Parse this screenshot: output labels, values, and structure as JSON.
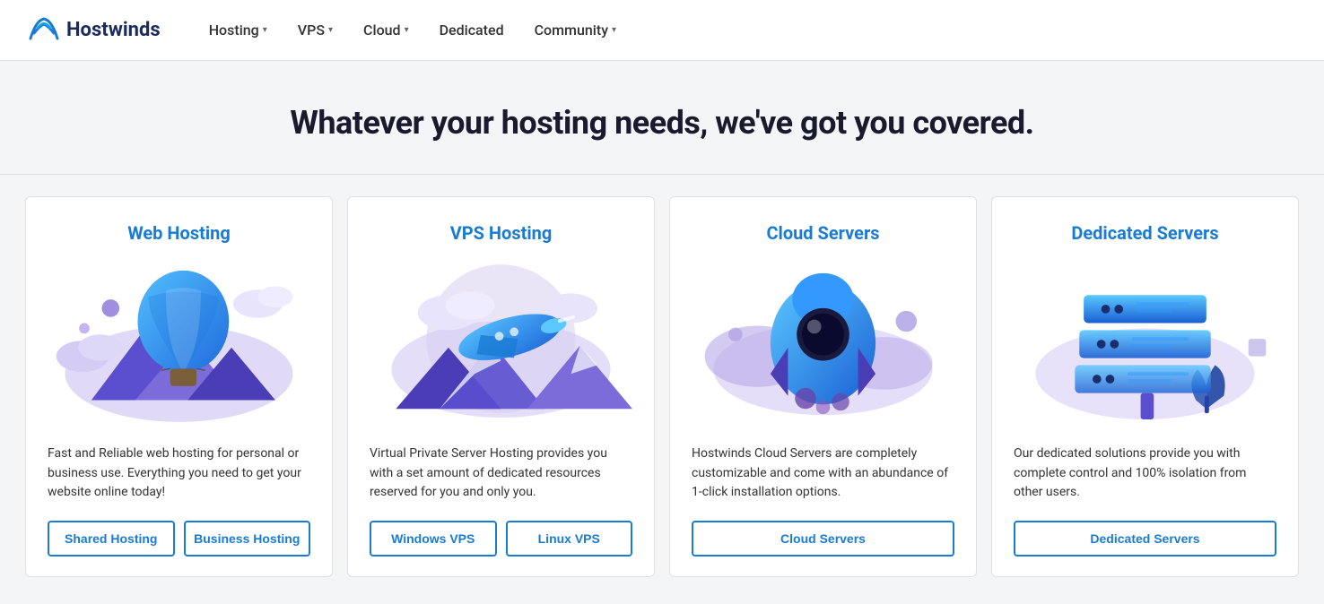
{
  "navbar": {
    "logo_text": "Hostwinds",
    "items": [
      {
        "label": "Hosting",
        "has_dropdown": true
      },
      {
        "label": "VPS",
        "has_dropdown": true
      },
      {
        "label": "Cloud",
        "has_dropdown": true
      },
      {
        "label": "Dedicated",
        "has_dropdown": false
      },
      {
        "label": "Community",
        "has_dropdown": true
      }
    ]
  },
  "hero": {
    "headline": "Whatever your hosting needs, we've got you covered."
  },
  "cards": [
    {
      "id": "web-hosting",
      "title": "Web Hosting",
      "description": "Fast and Reliable web hosting for personal or business use. Everything you need to get your website online today!",
      "buttons": [
        "Shared Hosting",
        "Business Hosting"
      ]
    },
    {
      "id": "vps-hosting",
      "title": "VPS Hosting",
      "description": "Virtual Private Server Hosting provides you with a set amount of dedicated resources reserved for you and only you.",
      "buttons": [
        "Windows VPS",
        "Linux VPS"
      ]
    },
    {
      "id": "cloud-servers",
      "title": "Cloud Servers",
      "description": "Hostwinds Cloud Servers are completely customizable and come with an abundance of 1-click installation options.",
      "buttons": [
        "Cloud Servers"
      ]
    },
    {
      "id": "dedicated-servers",
      "title": "Dedicated Servers",
      "description": "Our dedicated solutions provide you with complete control and 100% isolation from other users.",
      "buttons": [
        "Dedicated Servers"
      ]
    }
  ]
}
